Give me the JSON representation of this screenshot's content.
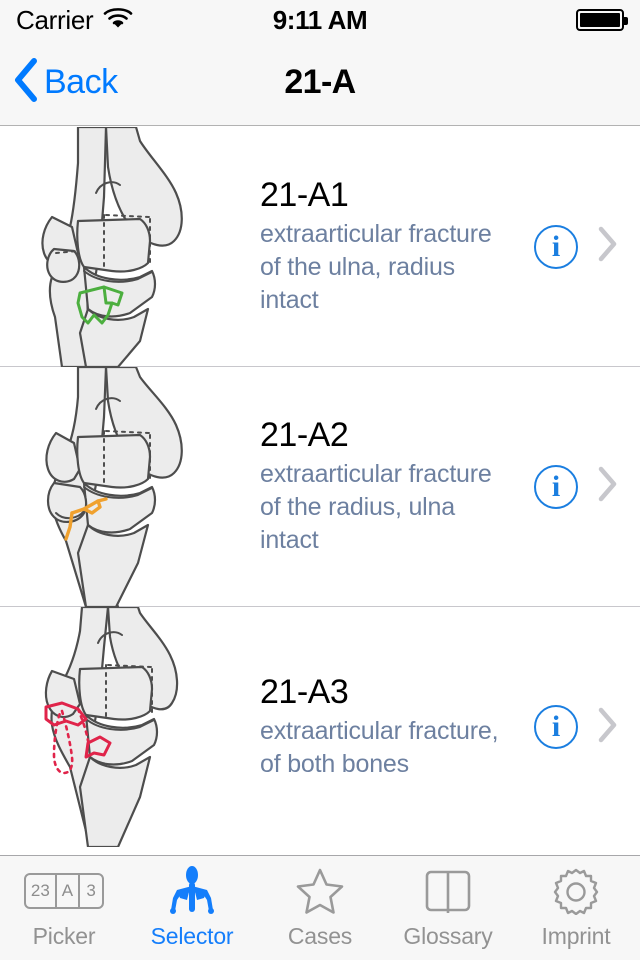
{
  "status_bar": {
    "carrier": "Carrier",
    "wifi_icon": "wifi-icon",
    "time": "9:11 AM",
    "battery_icon": "battery-full-icon"
  },
  "nav_bar": {
    "back_icon": "chevron-left-icon",
    "back_label": "Back",
    "title": "21-A"
  },
  "colors": {
    "tint": "#007aff",
    "subtitle": "#6d80a0",
    "info_blue": "#1a7ee0",
    "fracture_green": "#4caf3f",
    "fracture_orange": "#f0a12e",
    "fracture_red": "#e0244a",
    "bone_fill": "#ececec",
    "bone_stroke": "#4d4d4d",
    "separator": "#c8c7cc",
    "tab_inactive": "#929292",
    "tab_active": "#147efb"
  },
  "list": {
    "rows": [
      {
        "title": "21-A1",
        "subtitle": "extraarticular fracture of the ulna, radius intact",
        "figure": "elbow-fracture-diagram-green",
        "fracture_color": "#4caf3f",
        "info_label": "i",
        "disclosure_icon": "chevron-right-icon"
      },
      {
        "title": "21-A2",
        "subtitle": "extraarticular fracture of the radius, ulna intact",
        "figure": "elbow-fracture-diagram-orange",
        "fracture_color": "#f0a12e",
        "info_label": "i",
        "disclosure_icon": "chevron-right-icon"
      },
      {
        "title": "21-A3",
        "subtitle": "extraarticular fracture, of both bones",
        "figure": "elbow-fracture-diagram-red",
        "fracture_color": "#e0244a",
        "info_label": "i",
        "disclosure_icon": "chevron-right-icon"
      }
    ]
  },
  "tab_bar": {
    "tabs": [
      {
        "label": "Picker",
        "icon": "picker-segments-icon",
        "active": false,
        "picker_cells": [
          "23",
          "A",
          "3"
        ]
      },
      {
        "label": "Selector",
        "icon": "skeleton-icon",
        "active": true
      },
      {
        "label": "Cases",
        "icon": "star-icon",
        "active": false
      },
      {
        "label": "Glossary",
        "icon": "open-book-icon",
        "active": false
      },
      {
        "label": "Imprint",
        "icon": "gear-icon",
        "active": false
      }
    ]
  }
}
